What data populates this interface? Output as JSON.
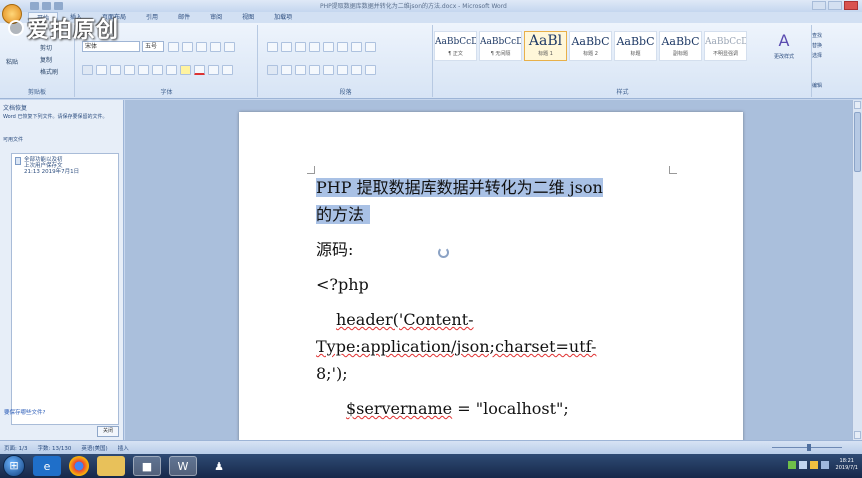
{
  "watermark": {
    "text": "爱拍原创"
  },
  "window": {
    "title": "PHP提取数据库数据并转化为二维json的方法.docx - Microsoft Word"
  },
  "ribbon": {
    "tabs": [
      "开始",
      "插入",
      "页面布局",
      "引用",
      "邮件",
      "审阅",
      "视图",
      "加载项"
    ],
    "active_tab": "开始",
    "groups": {
      "clipboard": "剪贴板",
      "font": "字体",
      "paragraph": "段落",
      "styles": "样式",
      "editing": "编辑"
    },
    "clipboard": {
      "paste": "粘贴",
      "cut": "剪切",
      "copy": "复制",
      "format_painter": "格式刷"
    },
    "font": {
      "family": "宋体",
      "size": "五号"
    },
    "styles": [
      {
        "sample": "AaBbCcD",
        "name": "¶ 正文"
      },
      {
        "sample": "AaBbCcD",
        "name": "¶ 无间隔"
      },
      {
        "sample": "AaBl",
        "name": "标题 1"
      },
      {
        "sample": "AaBbC",
        "name": "标题 2"
      },
      {
        "sample": "AaBbC",
        "name": "标题"
      },
      {
        "sample": "AaBbC",
        "name": "副标题"
      },
      {
        "sample": "AaBbCcD",
        "name": "不明显强调"
      }
    ],
    "change_styles": "更改样式",
    "editing": {
      "find": "查找",
      "replace": "替换",
      "select": "选择"
    }
  },
  "left_pane": {
    "header": "文档恢复",
    "description": "Word 已恢复下列文件。请保存要保留的文件。",
    "list_header": "可用文件",
    "documents": [
      {
        "line1": "全部功能以及初",
        "line2": "上次用户保存文",
        "line3": "21:13 2019年7月1日"
      }
    ],
    "link": "要保存哪些文件?",
    "close_button": "关闭"
  },
  "document": {
    "title_line1": "PHP 提取数据库数据并转化为二维 json",
    "title_line2": "的方法",
    "label": "源码:",
    "code": {
      "open_tag": "<?php",
      "header_line1": "header('Content-",
      "header_line2": "Type:application/json;charset=utf-",
      "header_line3": "8;');",
      "servername_var": "$servername",
      "servername_rest": " = \"localhost\";"
    }
  },
  "statusbar": {
    "page": "页面: 1/3",
    "words": "字数: 13/130",
    "language": "英语(美国)",
    "mode": "插入"
  },
  "taskbar": {
    "start_icon": "windows-start-icon",
    "clock_time": "18:21",
    "clock_date": "2019/7/1"
  }
}
